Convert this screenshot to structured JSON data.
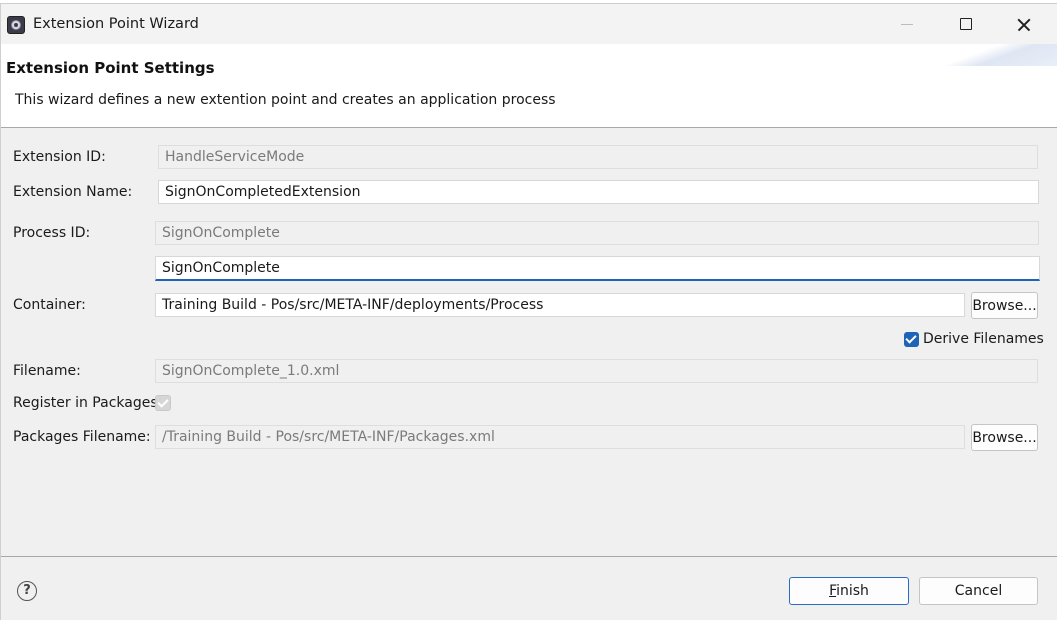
{
  "window": {
    "title": "Extension Point Wizard",
    "icon": "eclipse-icon"
  },
  "header": {
    "title": "Extension Point Settings",
    "description": "This wizard defines a new extention point and creates an application process"
  },
  "form": {
    "extension_id": {
      "label": "Extension ID:",
      "value": "HandleServiceMode"
    },
    "extension_name": {
      "label": "Extension Name:",
      "value": "SignOnCompletedExtension"
    },
    "process_id": {
      "label": "Process ID:",
      "value": "SignOnComplete",
      "input_value": "SignOnComplete"
    },
    "container": {
      "label": "Container:",
      "value": "Training Build - Pos/src/META-INF/deployments/Process",
      "browse_label": "Browse..."
    },
    "derive_filenames": {
      "label": "Derive Filenames",
      "checked": true
    },
    "filename": {
      "label": "Filename:",
      "value": "SignOnComplete_1.0.xml"
    },
    "register_in_packages": {
      "label": "Register in Packages:",
      "checked": true
    },
    "packages_filename": {
      "label": "Packages Filename:",
      "value": "/Training Build - Pos/src/META-INF/Packages.xml",
      "browse_label": "Browse..."
    }
  },
  "footer": {
    "help_symbol": "?",
    "finish_label": "Finish",
    "cancel_label": "Cancel"
  },
  "colors": {
    "accent": "#1d63b8",
    "dialog_bg": "#f0f0f0",
    "header_bg": "#ffffff"
  }
}
